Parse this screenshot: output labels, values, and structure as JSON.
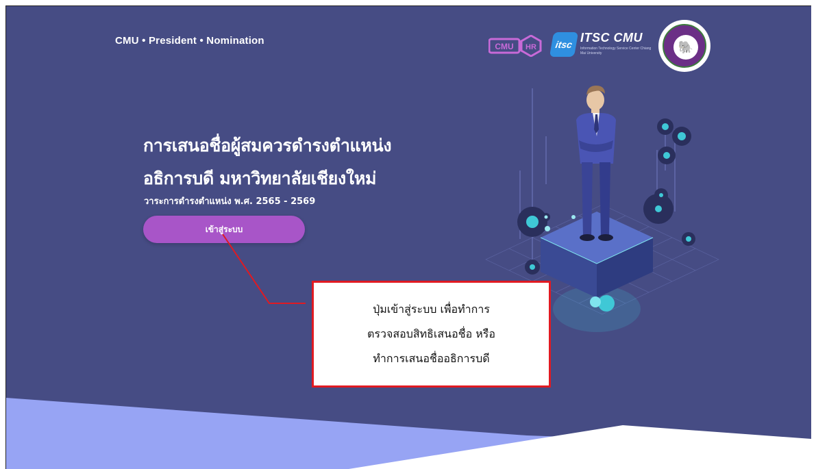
{
  "header": {
    "brand": "CMU • President • Nomination",
    "logos": {
      "cmu_hr": "CMUHR",
      "itsc_badge": "itsc",
      "itsc_title": "ITSC CMU",
      "itsc_subtitle": "Information Technology Service Center Chiang Mai University",
      "seal": "Chiang Mai University seal"
    }
  },
  "hero": {
    "title_line1": "การเสนอชื่อผู้สมควรดำรงตำแหน่ง",
    "title_line2": "อธิการบดี มหาวิทยาลัยเชียงใหม่",
    "subtitle": "วาระการดำรงตำแหน่ง พ.ศ. 2565 - 2569",
    "enter_button": "เข้าสู่ระบบ"
  },
  "callout": {
    "lines": [
      "ปุ่มเข้าสู่ระบบ เพื่อทำการ",
      "ตรวจสอบสิทธิเสนอชื่อ หรือ",
      "ทำการเสนอชื่ออธิการบดี"
    ]
  },
  "colors": {
    "background": "#464c84",
    "button": "#a855c8",
    "callout_border": "#e01a22",
    "accent_cyan": "#3fc8d6",
    "wave_light": "#97a4f4"
  },
  "icons": {
    "illustration": "businessman-on-tech-pedestal-illustration",
    "seal": "elephant-seal-icon"
  }
}
